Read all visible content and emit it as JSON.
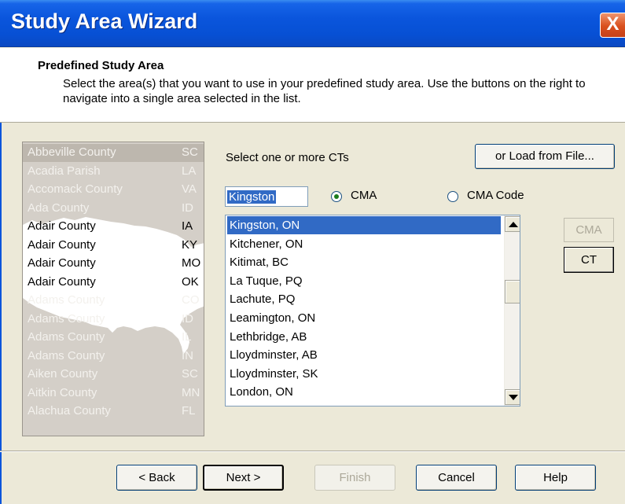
{
  "window": {
    "title": "Study Area Wizard",
    "close_label": "X"
  },
  "header": {
    "title": "Predefined Study Area",
    "description": "Select the area(s) that you want to use in your predefined study area.  Use the buttons on the right to navigate into a single area selected in the list."
  },
  "side_panel": {
    "counties": [
      {
        "name": "Abbeville County",
        "state": "SC"
      },
      {
        "name": "Acadia Parish",
        "state": "LA"
      },
      {
        "name": "Accomack County",
        "state": "VA"
      },
      {
        "name": "Ada County",
        "state": "ID"
      },
      {
        "name": "Adair County",
        "state": "IA"
      },
      {
        "name": "Adair County",
        "state": "KY"
      },
      {
        "name": "Adair County",
        "state": "MO"
      },
      {
        "name": "Adair County",
        "state": "OK"
      },
      {
        "name": "Adams County",
        "state": "CO"
      },
      {
        "name": "Adams County",
        "state": "ID"
      },
      {
        "name": "Adams County",
        "state": "IL"
      },
      {
        "name": "Adams County",
        "state": "IN"
      },
      {
        "name": "Aiken County",
        "state": "SC"
      },
      {
        "name": "Aitkin County",
        "state": "MN"
      },
      {
        "name": "Alachua County",
        "state": "FL"
      }
    ]
  },
  "main": {
    "prompt": "Select one or more CTs",
    "load_button": "or Load from File...",
    "search_value": "Kingston",
    "radio_cma": "CMA",
    "radio_cma_code": "CMA Code",
    "selected_radio": "CMA",
    "list_items": [
      "Kingston, ON",
      "Kitchener, ON",
      "Kitimat, BC",
      "La Tuque, PQ",
      "Lachute, PQ",
      "Leamington, ON",
      "Lethbridge, AB",
      "Lloydminster, AB",
      "Lloydminster, SK",
      "London, ON"
    ],
    "selected_item": "Kingston, ON",
    "nav_cma": "CMA",
    "nav_ct": "CT"
  },
  "footer": {
    "back": "< Back",
    "next": "Next >",
    "finish": "Finish",
    "cancel": "Cancel",
    "help": "Help"
  }
}
